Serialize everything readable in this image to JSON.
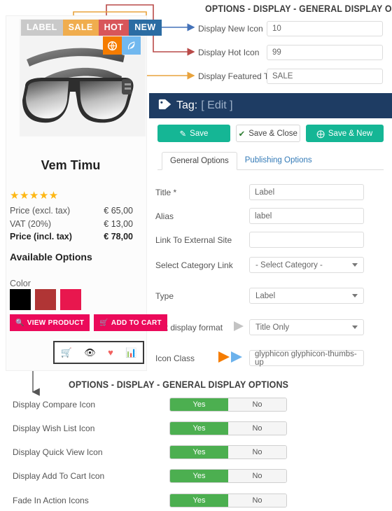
{
  "product": {
    "badges": [
      {
        "text": "LABEL",
        "kind": "label"
      },
      {
        "text": "SALE",
        "kind": "sale"
      },
      {
        "text": "HOT",
        "kind": "hot"
      },
      {
        "text": "NEW",
        "kind": "new"
      }
    ],
    "icon_badges": [
      {
        "icon": "globe-icon",
        "glyph": "@",
        "kind": "orange"
      },
      {
        "icon": "leaf-icon",
        "glyph": "❦",
        "kind": "blue"
      }
    ],
    "title": "Vem Timu",
    "rating_stars": "★★★★★",
    "prices": [
      {
        "label": "Price (excl. tax)",
        "value": "€ 65,00",
        "emphasis": false
      },
      {
        "label": "VAT (20%)",
        "value": "€ 13,00",
        "emphasis": false
      },
      {
        "label": "Price (incl. tax)",
        "value": "€ 78,00",
        "emphasis": true
      }
    ],
    "available_options_heading": "Available Options",
    "color_label": "Color",
    "swatches": [
      "#000000",
      "#b03535",
      "#e8174e"
    ],
    "view_product_label": "VIEW PRODUCT",
    "add_to_cart_label": "ADD TO CART",
    "action_icons": [
      {
        "name": "cart-icon",
        "glyph": "🛒",
        "color": "#222222"
      },
      {
        "name": "eye-icon",
        "glyph": "👁",
        "color": "#222222"
      },
      {
        "name": "heart-icon",
        "glyph": "♥",
        "color": "#f2615f"
      },
      {
        "name": "compare-icon",
        "glyph": "📊",
        "color": "#2f7fd1"
      }
    ]
  },
  "top_section": {
    "title": "OPTIONS - DISPLAY - GENERAL DISPLAY OPTIONS",
    "fields": [
      {
        "label": "Display New Icon",
        "value": "10",
        "arrow_color": "#4472b8"
      },
      {
        "label": "Display Hot Icon",
        "value": "99",
        "arrow_color": "#b94a48"
      },
      {
        "label": "Display Featured Text",
        "value": "SALE",
        "arrow_color": "#e8a33d"
      }
    ]
  },
  "tag_panel": {
    "heading_word": "Tag:",
    "heading_edit": "[ Edit ]",
    "tag_icon": "tag-icon",
    "buttons": [
      {
        "label": "Save",
        "icon": "pencil-square-icon",
        "glyph": "✎",
        "style": "solid"
      },
      {
        "label": "Save & Close",
        "icon": "check-icon",
        "glyph": "✔",
        "style": "ghost"
      },
      {
        "label": "Save & New",
        "icon": "plus-circle-icon",
        "glyph": "⊕",
        "style": "solid"
      }
    ],
    "tabs": [
      {
        "label": "General Options",
        "active": true
      },
      {
        "label": "Publishing Options",
        "active": false
      }
    ],
    "fields": {
      "title_label": "Title *",
      "title_value": "Label",
      "alias_label": "Alias",
      "alias_value": "label",
      "link_label": "Link To External Site",
      "link_value": "",
      "category_label": "Select Category Link",
      "category_value": "- Select Category -",
      "type_label": "Type",
      "type_value": "Label",
      "format_label": "Set display format",
      "format_value": "Title Only",
      "iconclass_label": "Icon Class",
      "iconclass_value": "glyphicon glyphicon-thumbs-up"
    }
  },
  "bottom_section": {
    "title": "OPTIONS - DISPLAY - GENERAL DISPLAY OPTIONS",
    "yes_label": "Yes",
    "no_label": "No",
    "rows": [
      {
        "label": "Display Compare Icon",
        "value": "Yes"
      },
      {
        "label": "Display Wish List Icon",
        "value": "Yes"
      },
      {
        "label": "Display Quick View Icon",
        "value": "Yes"
      },
      {
        "label": "Display Add To Cart Icon",
        "value": "Yes"
      },
      {
        "label": "Fade In Action Icons",
        "value": "Yes"
      }
    ]
  },
  "colors": {
    "arrow_blue": "#4472b8",
    "arrow_red": "#b94a48",
    "arrow_orange": "#e8a33d",
    "arrow_lightblue": "#55a8e2",
    "arrow_gray": "#b9b9b9",
    "panel_navy": "#1e3c63",
    "accent_teal": "#15b695",
    "toggle_green": "#4caf50",
    "badge_gray": "#c9c9c9",
    "badge_orange": "#f0ad4e",
    "badge_red": "#d8565a",
    "badge_blue": "#2b6ca3",
    "cart_pink": "#eb0a5a"
  }
}
